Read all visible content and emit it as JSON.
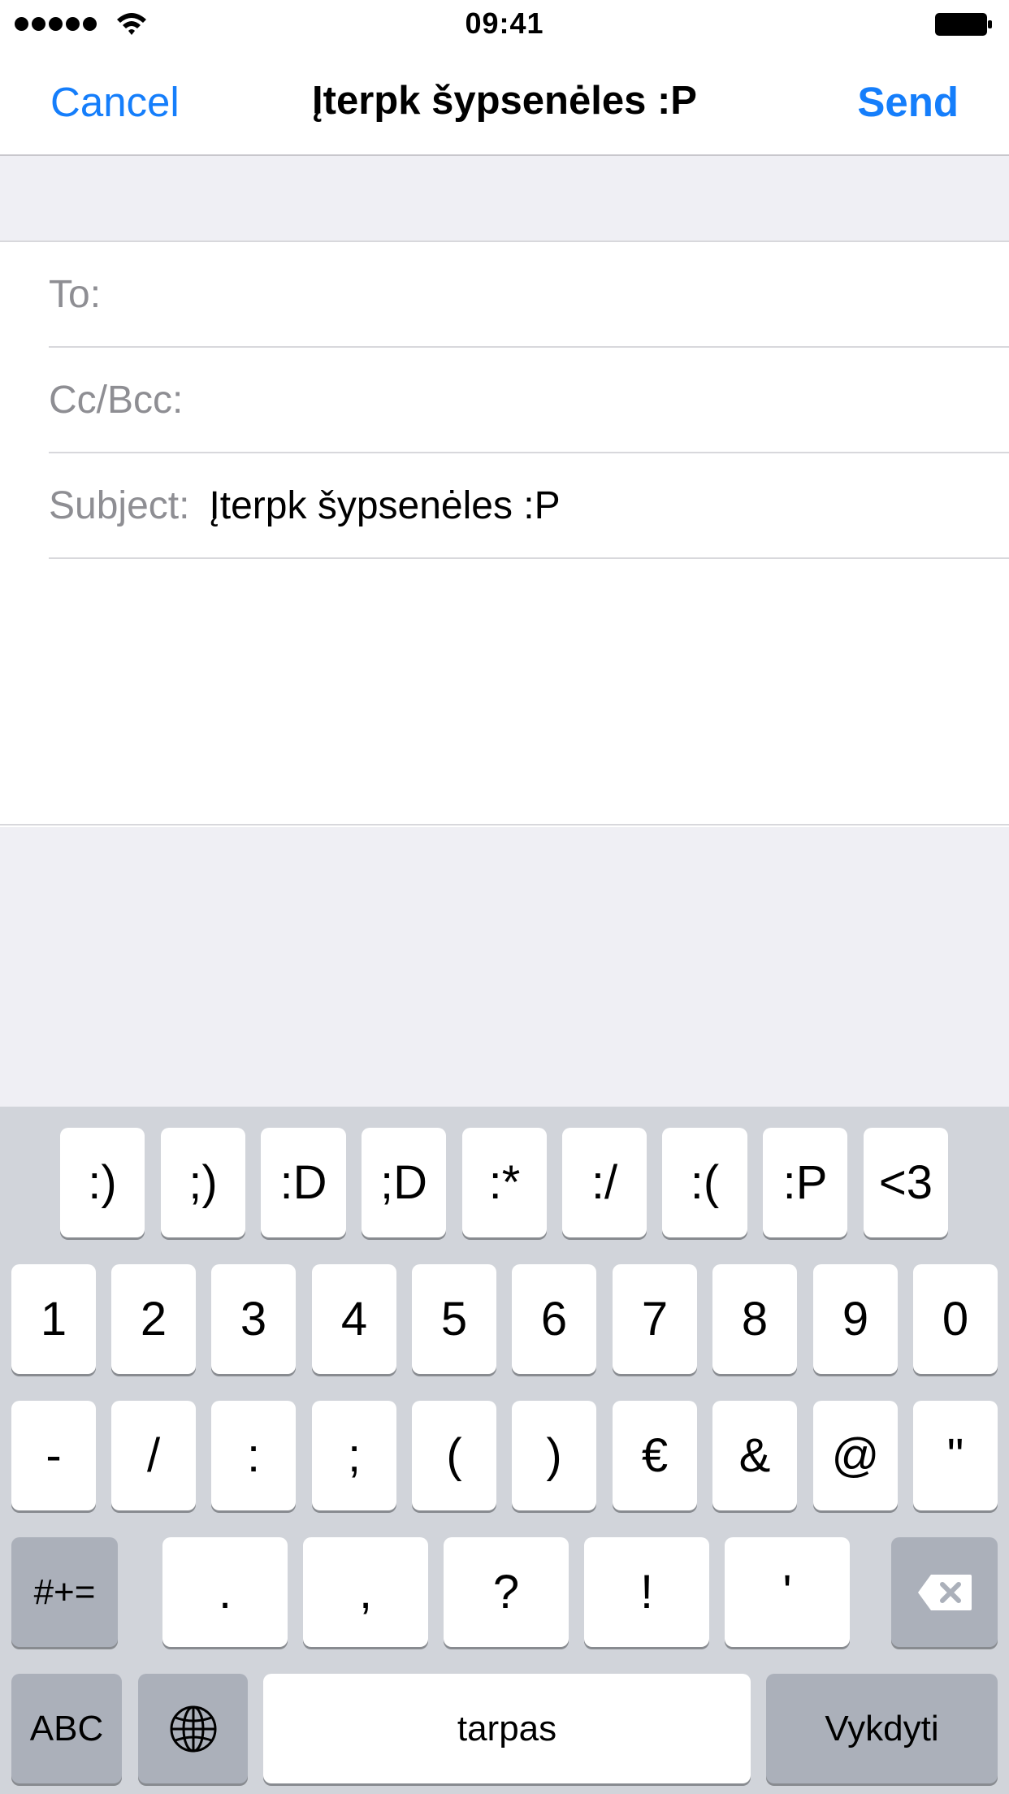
{
  "status_bar": {
    "time": "09:41"
  },
  "nav": {
    "cancel_label": "Cancel",
    "title": "Įterpk šypsenėles :P",
    "send_label": "Send"
  },
  "fields": {
    "to_label": "To:",
    "cc_label": "Cc/Bcc:",
    "subject_label": "Subject:",
    "subject_value": "Įterpk šypsenėles :P"
  },
  "keyboard": {
    "smiley_row": [
      ":)",
      ";)",
      ":D",
      ";D",
      ":*",
      ":/",
      ":(",
      ":P",
      "<3"
    ],
    "digit_row": [
      "1",
      "2",
      "3",
      "4",
      "5",
      "6",
      "7",
      "8",
      "9",
      "0"
    ],
    "symbol_row": [
      "-",
      "/",
      ":",
      ";",
      "(",
      ")",
      "€",
      "&",
      "@",
      "\""
    ],
    "punct_row": [
      ".",
      ",",
      "?",
      "!",
      "'"
    ],
    "more_symbols_label": "#+=",
    "abc_label": "ABC",
    "space_label": "tarpas",
    "return_label": "Vykdyti",
    "icons": {
      "backspace": "backspace-icon",
      "globe": "globe-icon"
    }
  },
  "colors": {
    "accent": "#157efb",
    "keyboard_bg": "#d1d4da",
    "gray_bg": "#efeff4"
  }
}
